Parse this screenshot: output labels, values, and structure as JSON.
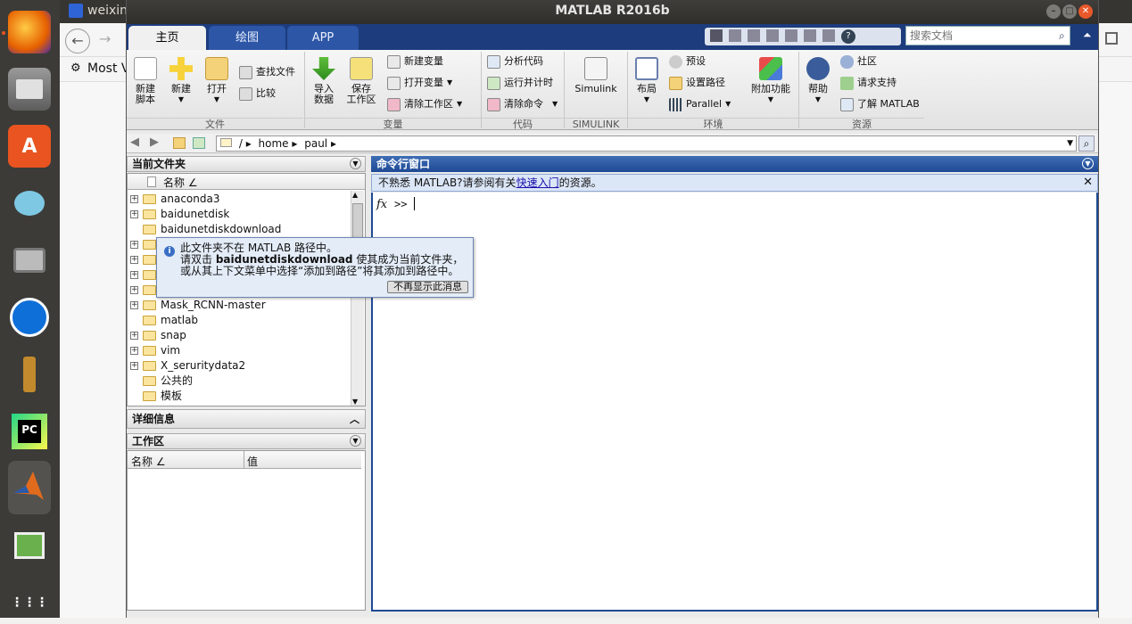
{
  "launcher": {
    "items": [
      "firefox-icon",
      "files-icon",
      "software-icon",
      "wechat-icon",
      "camera-icon",
      "teamviewer-icon",
      "lamp-icon",
      "pycharm-icon",
      "matlab-icon",
      "viewer-icon",
      "apps-grid-icon"
    ]
  },
  "browser": {
    "tab_title": "weixin",
    "bookmark": "Most V"
  },
  "window": {
    "title": "MATLAB R2016b"
  },
  "tabs": [
    "主页",
    "绘图",
    "APP"
  ],
  "search": {
    "placeholder": "搜索文档"
  },
  "ribbon": {
    "file": {
      "new_script": "新建\n脚本",
      "new": "新建",
      "open": "打开",
      "find_files": "查找文件",
      "compare": "比较",
      "label": "文件"
    },
    "variable": {
      "import": "导入\n数据",
      "save_workspace": "保存\n工作区",
      "new_var": "新建变量",
      "open_var": "打开变量",
      "clear_ws": "清除工作区",
      "label": "变量"
    },
    "code": {
      "analyze": "分析代码",
      "run_time": "运行并计时",
      "clear_cmd": "清除命令",
      "label": "代码"
    },
    "simulink": {
      "btn": "Simulink",
      "label": "SIMULINK"
    },
    "env": {
      "layout": "布局",
      "prefs": "预设",
      "set_path": "设置路径",
      "parallel": "Parallel",
      "addons": "附加功能",
      "label": "环境"
    },
    "resources": {
      "help": "帮助",
      "community": "社区",
      "support": "请求支持",
      "learn": "了解 MATLAB",
      "label": "资源"
    }
  },
  "address": {
    "path": [
      "/",
      "home",
      "paul"
    ]
  },
  "current_folder": {
    "title": "当前文件夹",
    "col_name": "名称 ∠",
    "items": [
      {
        "name": "anaconda3",
        "expand": true
      },
      {
        "name": "baidunetdisk",
        "expand": true
      },
      {
        "name": "baidunetdiskdownload",
        "expand": false
      },
      {
        "name": "",
        "expand": true
      },
      {
        "name": "",
        "expand": true
      },
      {
        "name": "",
        "expand": true
      },
      {
        "name": "",
        "expand": true
      },
      {
        "name": "Mask_RCNN-master",
        "expand": true
      },
      {
        "name": "matlab",
        "expand": false
      },
      {
        "name": "snap",
        "expand": true
      },
      {
        "name": "vim",
        "expand": true
      },
      {
        "name": "X_seruritydata2",
        "expand": true
      },
      {
        "name": "公共的",
        "expand": false
      },
      {
        "name": "模板",
        "expand": false
      }
    ]
  },
  "details": {
    "title": "详细信息"
  },
  "workspace": {
    "title": "工作区",
    "col_name": "名称 ∠",
    "col_value": "值"
  },
  "command": {
    "title": "命令行窗口",
    "info_prefix": "不熟悉 MATLAB?请参阅有关",
    "info_link": "快速入门",
    "info_suffix": "的资源。",
    "prompt": ">>"
  },
  "tooltip": {
    "line1": "此文件夹不在 MATLAB 路径中。",
    "line2_prefix": "请双击 ",
    "line2_bold": "baidunetdiskdownload",
    "line2_suffix": " 使其成为当前文件夹，",
    "line3": "或从其上下文菜单中选择“添加到路径”将其添加到路径中。",
    "dismiss": "不再显示此消息"
  },
  "colors": {
    "accent": "#1f4a95",
    "launcher_bg": "#3c3b37",
    "titlebar": "#363532"
  }
}
